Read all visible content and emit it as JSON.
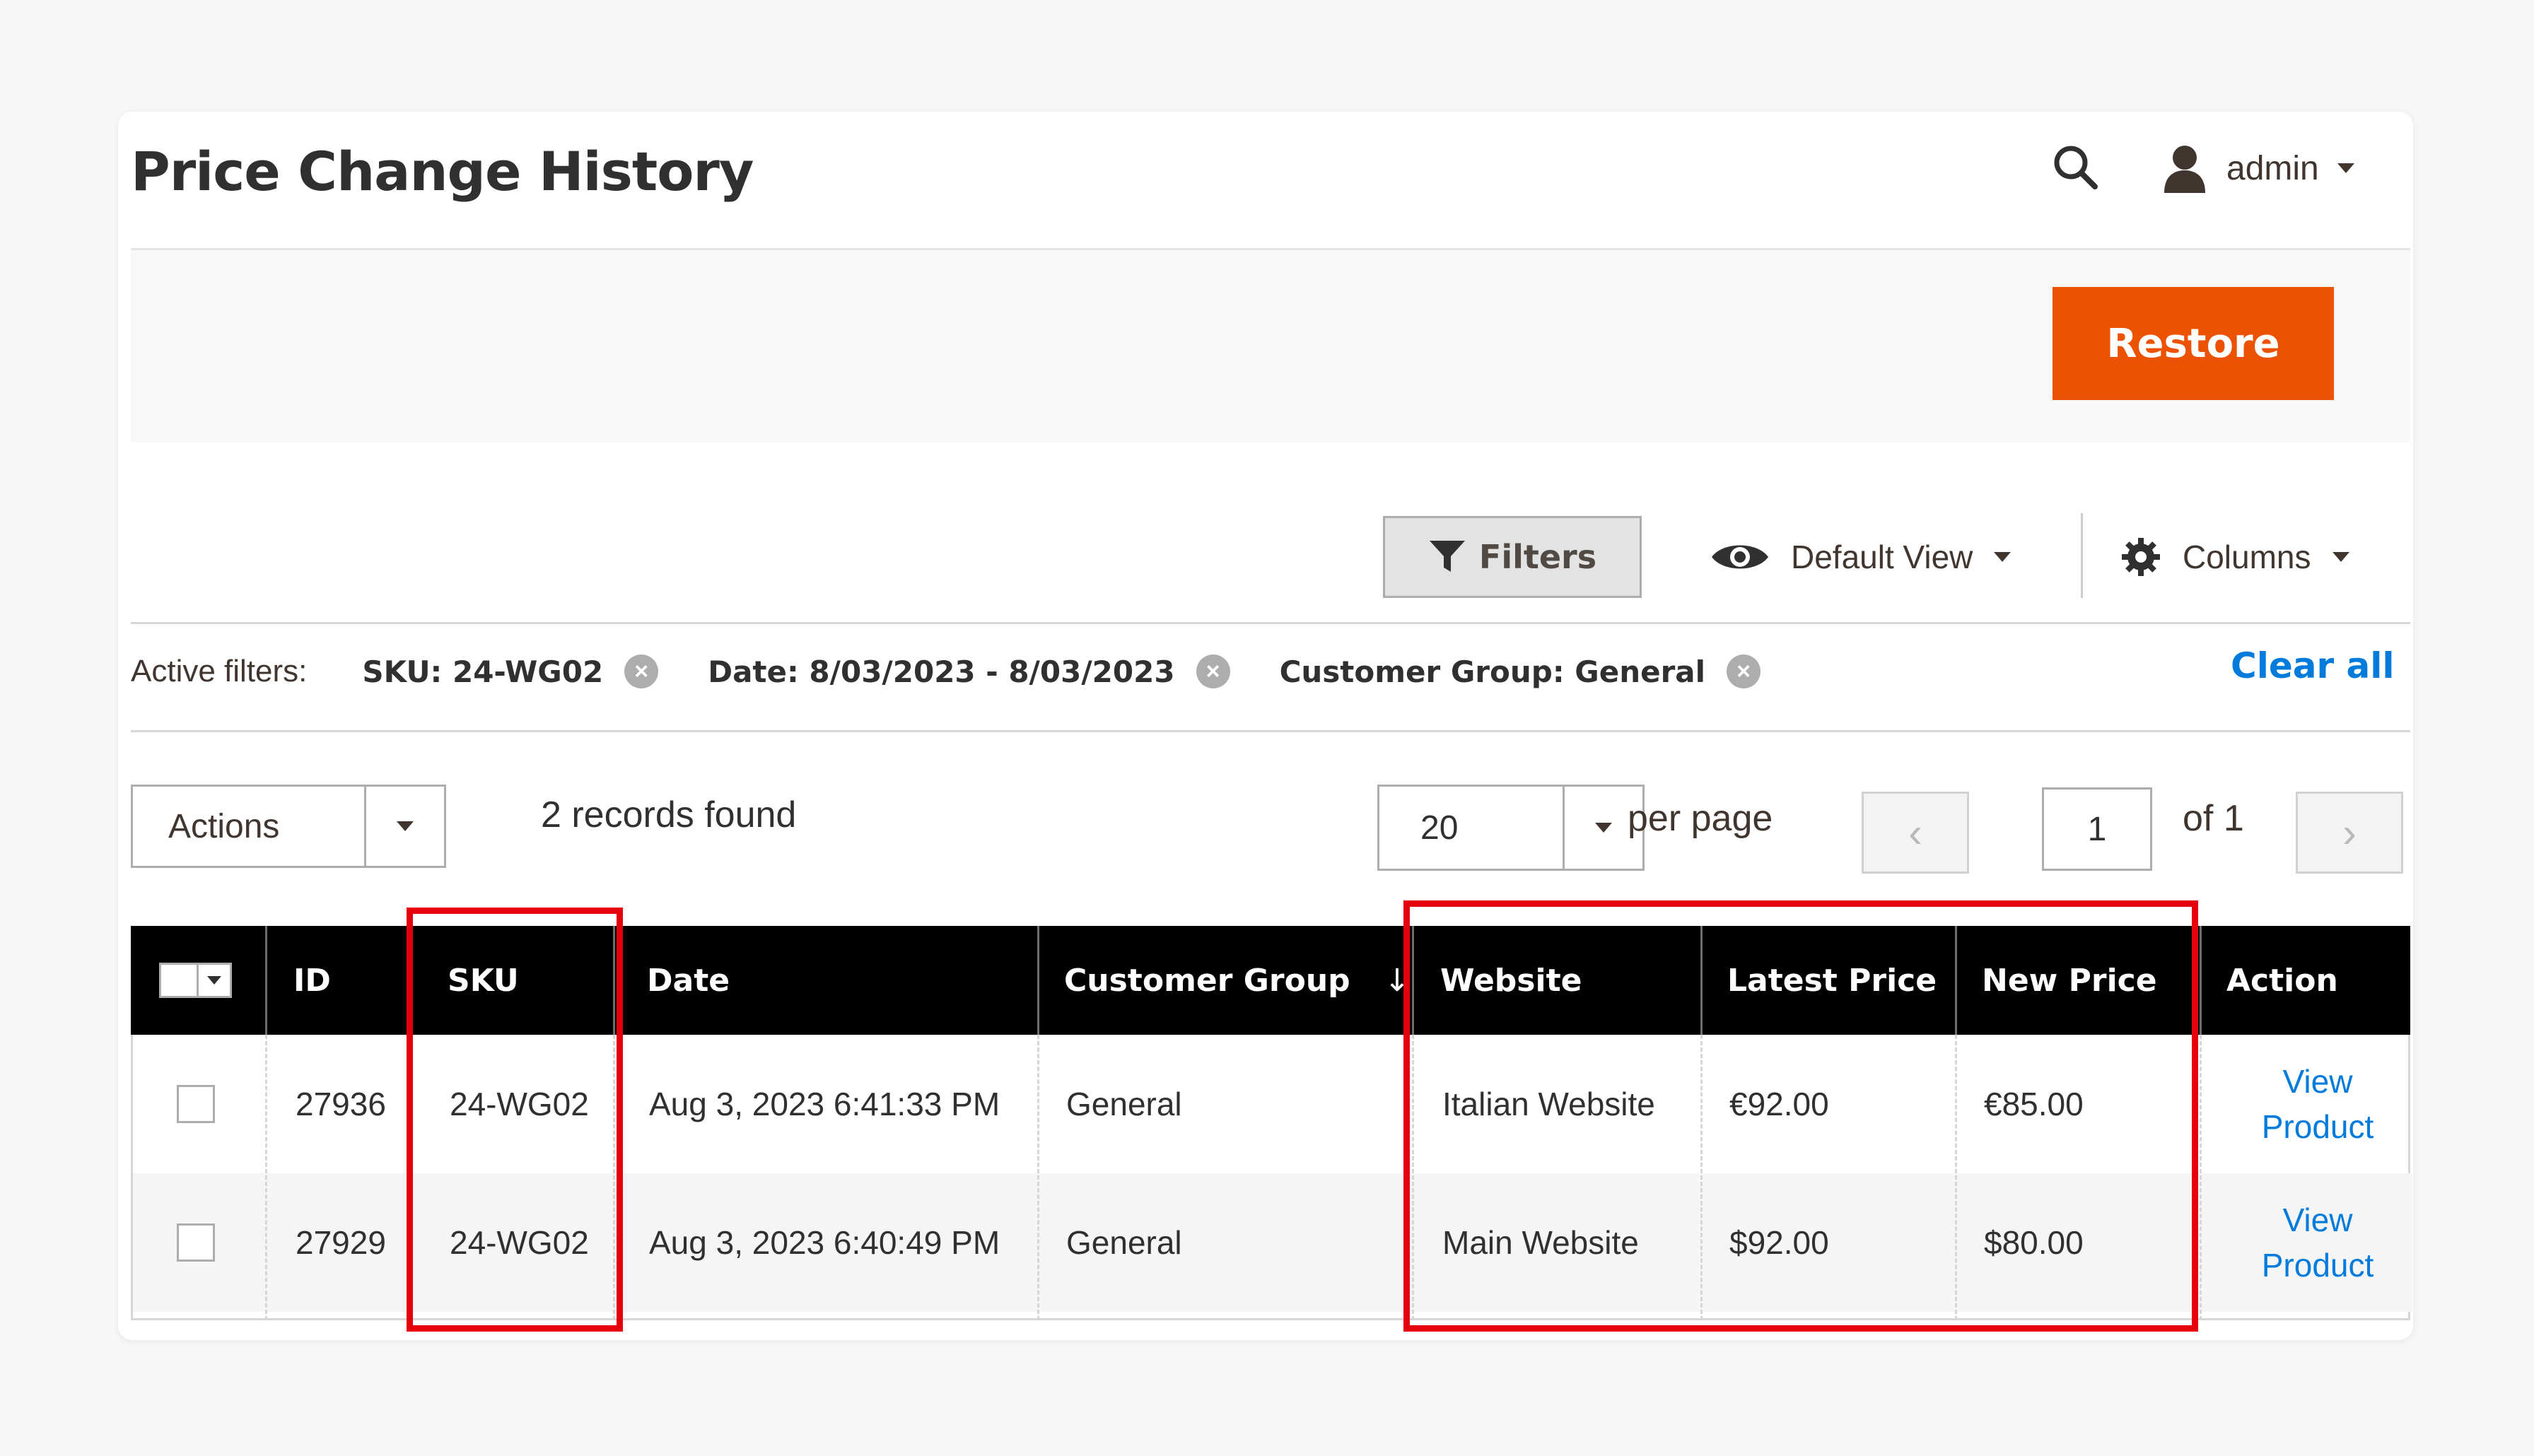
{
  "header": {
    "title": "Price Change History",
    "user": "admin",
    "search_icon": "search-icon",
    "user_icon": "user-icon"
  },
  "page_actions": {
    "restore_label": "Restore"
  },
  "toolbar": {
    "filters_label": "Filters",
    "view_label": "Default View",
    "columns_label": "Columns"
  },
  "active_filters": {
    "label": "Active filters:",
    "items": [
      {
        "text": "SKU: 24-WG02"
      },
      {
        "text": "Date: 8/03/2023 - 8/03/2023"
      },
      {
        "text": "Customer Group: General"
      }
    ],
    "clear_all": "Clear all"
  },
  "grid_controls": {
    "actions_label": "Actions",
    "records_found": "2 records found",
    "per_page_value": "20",
    "per_page_label": "per page",
    "current_page": "1",
    "total_pages_label": "of 1"
  },
  "table": {
    "columns": [
      "ID",
      "SKU",
      "Date",
      "Customer Group",
      "Website",
      "Latest Price",
      "New Price",
      "Action"
    ],
    "sort_indicator": "↓",
    "rows": [
      {
        "id": "27936",
        "sku": "24-WG02",
        "date": "Aug 3, 2023 6:41:33 PM",
        "group": "General",
        "website": "Italian Website",
        "latest": "€92.00",
        "new": "€85.00",
        "action_line1": "View",
        "action_line2": "Product"
      },
      {
        "id": "27929",
        "sku": "24-WG02",
        "date": "Aug 3, 2023 6:40:49 PM",
        "group": "General",
        "website": "Main Website",
        "latest": "$92.00",
        "new": "$80.00",
        "action_line1": "View",
        "action_line2": "Product"
      }
    ]
  },
  "colors": {
    "accent": "#eb5202",
    "link": "#007bdb",
    "highlight": "#e5000d",
    "header_bg": "#000000"
  }
}
